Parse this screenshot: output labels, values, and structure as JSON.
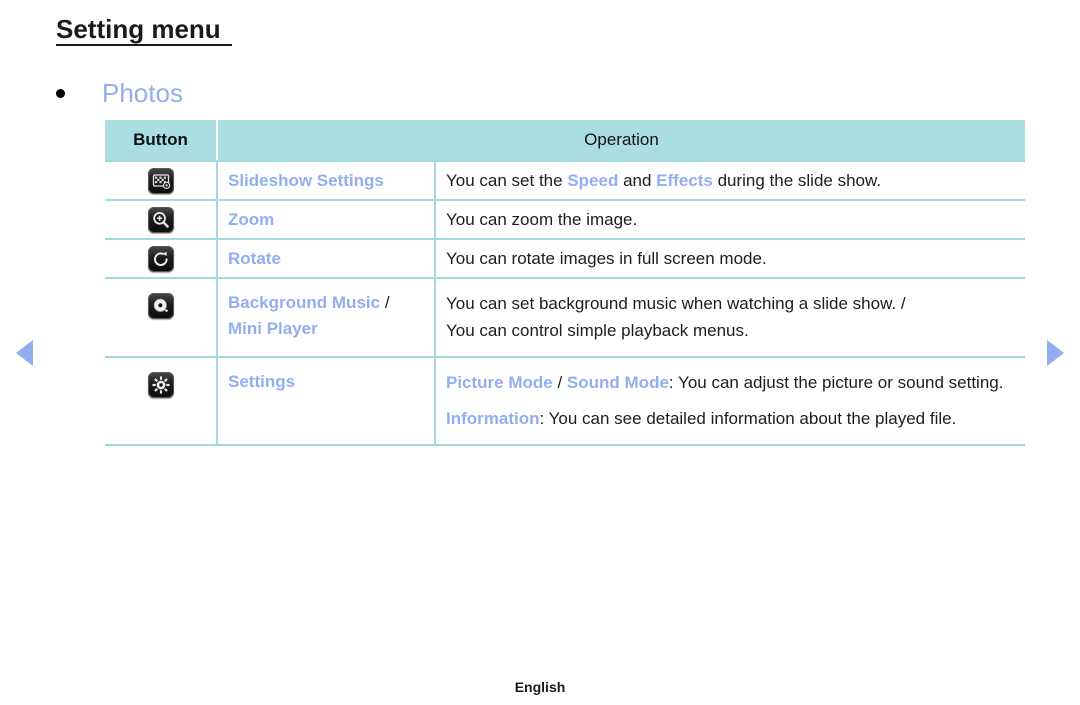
{
  "header": {
    "title": "Setting menu"
  },
  "section": {
    "bullet_icon": "bullet-dot-icon",
    "title": "Photos",
    "title_color": "#93aef0"
  },
  "colors": {
    "accent_blue": "#93aef0",
    "table_header_bg": "#aadee3",
    "table_border": "#a6d9de",
    "body_text": "#1d1d1d"
  },
  "table": {
    "columns": [
      "Button",
      "Operation"
    ],
    "rows": [
      {
        "icon": "slideshow-settings-icon",
        "name": "Slideshow Settings",
        "operation_plain": "You can set the Speed and Effects during the slide show.",
        "op_segments": [
          {
            "text": "You can set the ",
            "style": "plain"
          },
          {
            "text": "Speed",
            "style": "highlight"
          },
          {
            "text": " and ",
            "style": "plain"
          },
          {
            "text": "Effects",
            "style": "highlight"
          },
          {
            "text": " during the slide show.",
            "style": "plain"
          }
        ]
      },
      {
        "icon": "zoom-magnifier-icon",
        "name": "Zoom",
        "operation_plain": "You can zoom the image.",
        "op_segments": [
          {
            "text": "You can zoom the image.",
            "style": "plain"
          }
        ]
      },
      {
        "icon": "rotate-clockwise-icon",
        "name": "Rotate",
        "operation_plain": "You can rotate images in full screen mode.",
        "op_segments": [
          {
            "text": "You can rotate images in full screen mode.",
            "style": "plain"
          }
        ]
      },
      {
        "icon": "background-music-disc-icon",
        "name_line1_hl": "Background Music",
        "name_line1_sep": " /",
        "name_line2_hl": "Mini Player",
        "operation_plain": "You can set background music when watching a slide show. / You can control simple playback menus.",
        "op_line1": "You can set background music when watching a slide show. /",
        "op_line2": "You can control simple playback menus."
      },
      {
        "icon": "settings-gear-icon",
        "name": "Settings",
        "operation_plain": "Picture Mode / Sound Mode: You can adjust the picture or sound setting. Information: You can see detailed information about the played file.",
        "para1_segments": [
          {
            "text": "Picture Mode",
            "style": "highlight"
          },
          {
            "text": " / ",
            "style": "plain"
          },
          {
            "text": "Sound Mode",
            "style": "highlight"
          },
          {
            "text": ": You can adjust the picture or sound setting.",
            "style": "plain"
          }
        ],
        "para2_segments": [
          {
            "text": "Information",
            "style": "highlight"
          },
          {
            "text": ": You can see detailed information about the played file.",
            "style": "plain"
          }
        ]
      }
    ]
  },
  "navigation": {
    "prev_icon": "triangle-left-icon",
    "next_icon": "triangle-right-icon"
  },
  "footer": {
    "language": "English"
  }
}
